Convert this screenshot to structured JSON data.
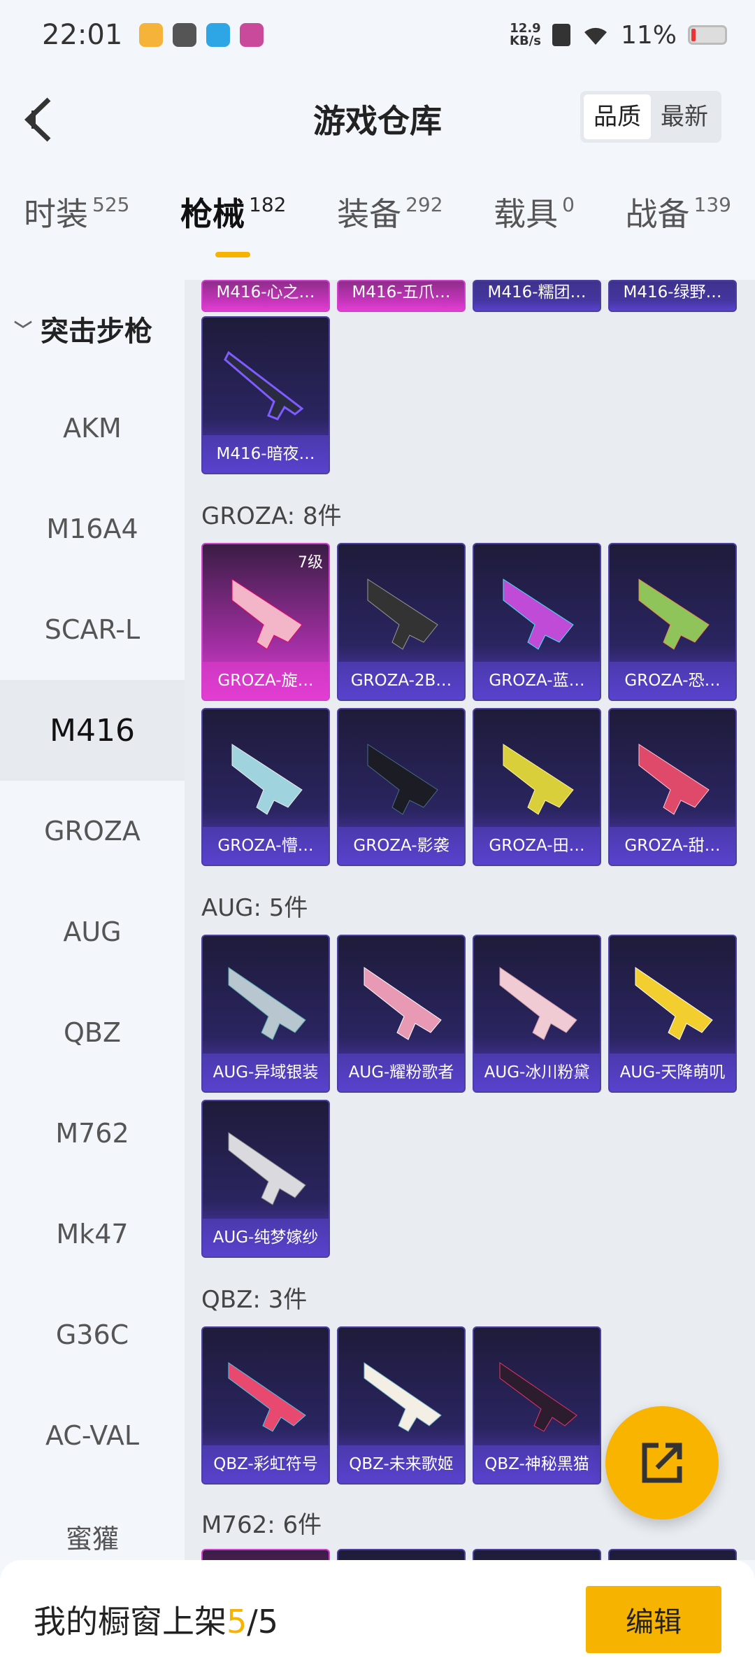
{
  "status": {
    "time": "22:01",
    "speed_top": "12.9",
    "speed_bottom": "KB/s",
    "battery": "11%"
  },
  "header": {
    "title": "游戏仓库",
    "sort_options": [
      "品质",
      "最新"
    ],
    "sort_selected": "品质"
  },
  "tabs": [
    {
      "label": "时装",
      "count": "525"
    },
    {
      "label": "枪械",
      "count": "182"
    },
    {
      "label": "装备",
      "count": "292"
    },
    {
      "label": "载具",
      "count": "0"
    },
    {
      "label": "战备",
      "count": "139"
    }
  ],
  "sidebar": {
    "group": "突击步枪",
    "items": [
      "AKM",
      "M16A4",
      "SCAR-L",
      "M416",
      "GROZA",
      "AUG",
      "QBZ",
      "M762",
      "Mk47",
      "G36C",
      "AC-VAL",
      "蜜獾"
    ],
    "active": "M416"
  },
  "content": {
    "m416_top": [
      "M416-心之…",
      "M416-五爪…",
      "M416-糯团…",
      "M416-绿野…"
    ],
    "m416_row": [
      "M416-暗夜…"
    ],
    "groza_header": "GROZA: 8件",
    "groza": [
      "GROZA-旋…",
      "GROZA-2B…",
      "GROZA-蓝…",
      "GROZA-恐…",
      "GROZA-懵…",
      "GROZA-影袭",
      "GROZA-田…",
      "GROZA-甜…"
    ],
    "groza_level": "7级",
    "aug_header": "AUG: 5件",
    "aug": [
      "AUG-异域银装",
      "AUG-耀粉歌者",
      "AUG-冰川粉黛",
      "AUG-天降萌叽",
      "AUG-纯梦嫁纱"
    ],
    "qbz_header": "QBZ: 3件",
    "qbz": [
      "QBZ-彩虹符号",
      "QBZ-未来歌姬",
      "QBZ-神秘黑猫"
    ],
    "m762_header": "M762: 6件"
  },
  "bottom": {
    "label": "我的橱窗上架",
    "current": "5",
    "total": "/5",
    "edit": "编辑"
  },
  "colors": {
    "accent": "#f6b400",
    "card_purple": "#2a2560",
    "card_pink": "#a12fa2"
  }
}
